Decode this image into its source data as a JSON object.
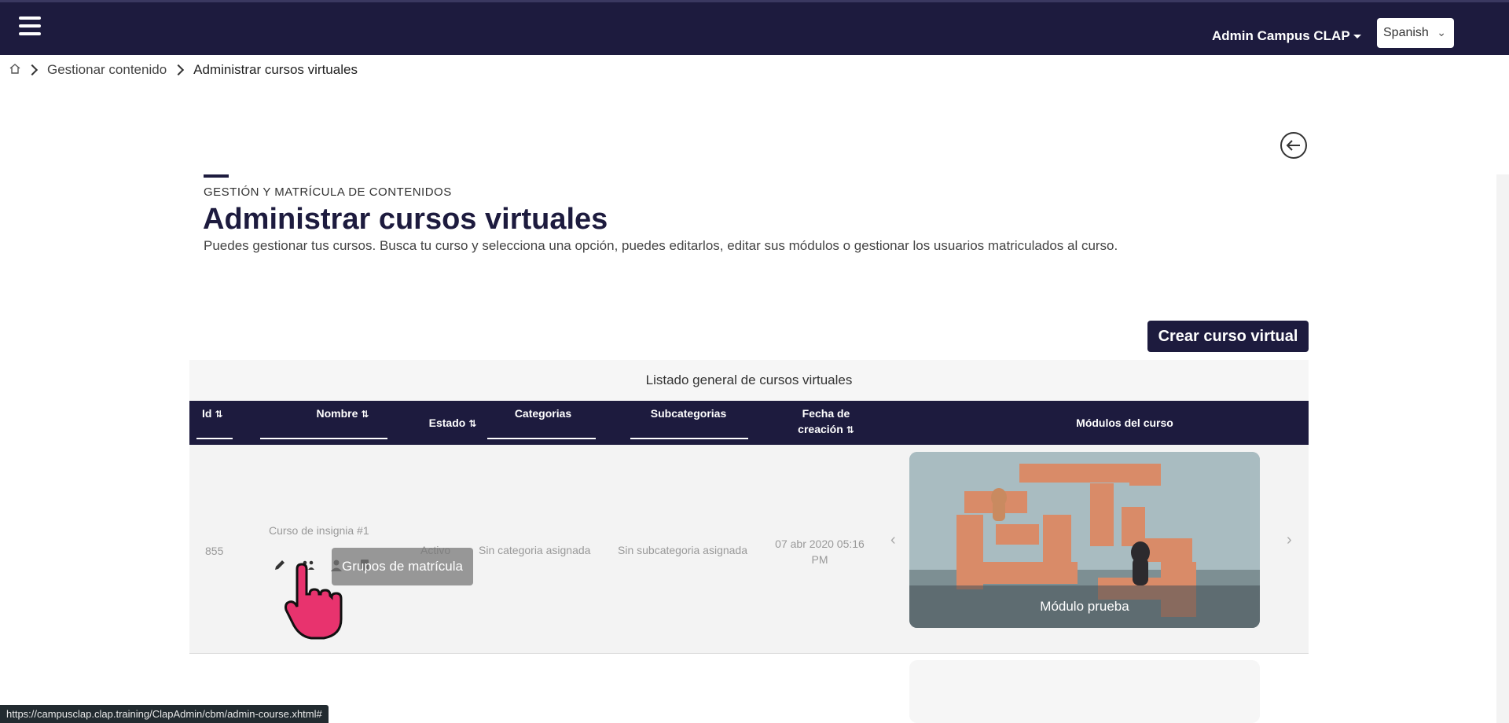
{
  "header": {
    "user_menu": "Admin Campus CLAP",
    "language": "Spanish"
  },
  "breadcrumb": {
    "items": [
      "Gestionar contenido",
      "Administrar cursos virtuales"
    ]
  },
  "page": {
    "section_label": "GESTIÓN Y MATRÍCULA DE CONTENIDOS",
    "title": "Administrar cursos virtuales",
    "description": "Puedes gestionar tus cursos. Busca tu curso y selecciona una opción, puedes editarlos, editar sus módulos o gestionar los usuarios matriculados al curso.",
    "create_button": "Crear curso virtual"
  },
  "table": {
    "caption": "Listado general de cursos virtuales",
    "columns": {
      "id": "Id",
      "name": "Nombre",
      "status": "Estado",
      "categories": "Categorias",
      "subcategories": "Subcategorias",
      "created_line1": "Fecha de",
      "created_line2": "creación",
      "modules": "Módulos del curso"
    },
    "rows": [
      {
        "id": "855",
        "name": "Curso de insignia #1",
        "status": "Activo",
        "category": "Sin categoria asignada",
        "subcategory": "Sin subcategoria asignada",
        "created_line1": "07 abr 2020 05:16",
        "created_line2": "PM",
        "module": "Módulo prueba"
      }
    ]
  },
  "tooltip": "Grupos de matrícula",
  "status_url": "https://campusclap.clap.training/ClapAdmin/cbm/admin-course.xhtml#",
  "colors": {
    "navy": "#1d1b3e",
    "cursor_pink": "#e8336e"
  }
}
